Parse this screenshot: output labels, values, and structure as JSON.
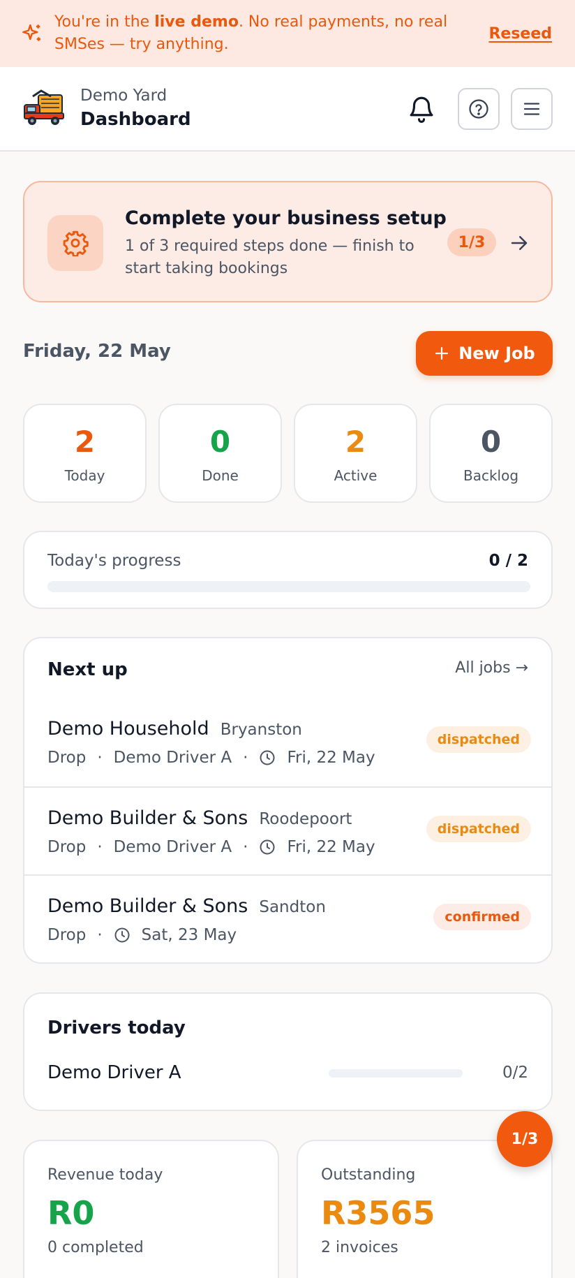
{
  "banner": {
    "text_prefix": "You're in the ",
    "text_bold": "live demo",
    "text_suffix": ". No real payments, no real SMSes — try anything.",
    "reseed_label": "Reseed",
    "icon": "sparkles-icon"
  },
  "header": {
    "yard_name": "Demo Yard",
    "title": "Dashboard",
    "icons": [
      "bell-icon",
      "help-icon",
      "menu-icon"
    ]
  },
  "setup": {
    "title": "Complete your business setup",
    "subtitle": "1 of 3 required steps done — finish to start taking bookings",
    "badge": "1/3",
    "icon": "gear-icon"
  },
  "date_label": "Friday, 22 May",
  "new_job_label": "New Job",
  "stats": [
    {
      "value": "2",
      "label": "Today",
      "color": "#ea580c"
    },
    {
      "value": "0",
      "label": "Done",
      "color": "#16a34a"
    },
    {
      "value": "2",
      "label": "Active",
      "color": "#ea8a10"
    },
    {
      "value": "0",
      "label": "Backlog",
      "color": "#4b5563"
    }
  ],
  "progress": {
    "label": "Today's progress",
    "count": "0 / 2",
    "fraction": 0
  },
  "next_up": {
    "title": "Next up",
    "all_jobs_label": "All jobs →",
    "jobs": [
      {
        "customer": "Demo Household",
        "area": "Bryanston",
        "type": "Drop",
        "driver": "Demo Driver A",
        "date": "Fri, 22 May",
        "status": "dispatched"
      },
      {
        "customer": "Demo Builder & Sons",
        "area": "Roodepoort",
        "type": "Drop",
        "driver": "Demo Driver A",
        "date": "Fri, 22 May",
        "status": "dispatched"
      },
      {
        "customer": "Demo Builder & Sons",
        "area": "Sandton",
        "type": "Drop",
        "driver": "",
        "date": "Sat, 23 May",
        "status": "confirmed"
      }
    ]
  },
  "drivers": {
    "title": "Drivers today",
    "items": [
      {
        "name": "Demo Driver A",
        "count": "0/2",
        "fraction": 0
      }
    ]
  },
  "revenue": {
    "label": "Revenue today",
    "value": "R0",
    "sub": "0 completed",
    "color": "#16a34a"
  },
  "outstanding": {
    "label": "Outstanding",
    "value": "R3565",
    "sub": "2 invoices",
    "color": "#ea8a10"
  },
  "fab_label": "1/3",
  "colors": {
    "accent": "#f15a0e",
    "banner_bg": "#fde9e1",
    "page_bg": "#faf9f7"
  }
}
